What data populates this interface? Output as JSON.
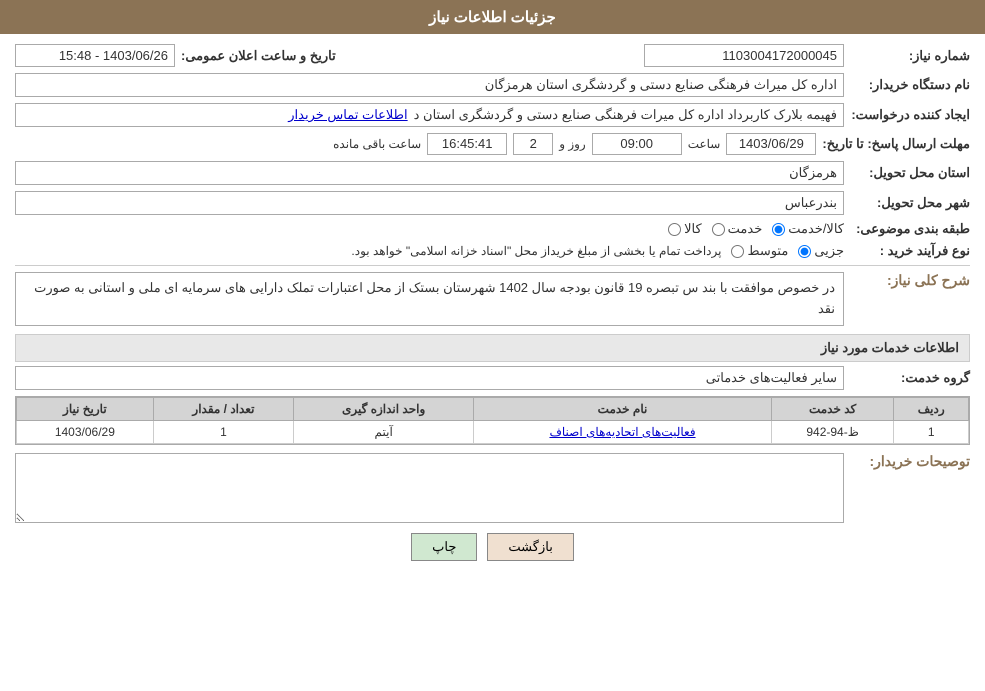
{
  "header": {
    "title": "جزئیات اطلاعات نیاز"
  },
  "fields": {
    "shomara_niaz_label": "شماره نیاز:",
    "shomara_niaz_value": "1103004172000045",
    "namdastgah_label": "نام دستگاه خریدار:",
    "namdastgah_value": "اداره کل میراث فرهنگی  صنایع دستی و گردشگری استان هرمزگان",
    "ijad_konande_label": "ایجاد کننده درخواست:",
    "ijad_konande_value": "فهیمه بلارک کاربرداد اداره کل میرات فرهنگی  صنایع دستی و گردشگری استان د",
    "ijad_konande_link": "اطلاعات تماس خریدار",
    "mohlet_label": "مهلت ارسال پاسخ: تا تاریخ:",
    "mohlet_date": "1403/06/29",
    "mohlet_saat_label": "ساعت",
    "mohlet_saat_value": "09:00",
    "mohlet_rooz_label": "روز و",
    "mohlet_rooz_value": "2",
    "mohlet_baghimande_label": "ساعت باقی مانده",
    "mohlet_baghimande_value": "16:45:41",
    "ostan_label": "استان محل تحویل:",
    "ostan_value": "هرمزگان",
    "shahr_label": "شهر محل تحویل:",
    "shahr_value": "بندرعباس",
    "tabaqe_label": "طبقه بندی موضوعی:",
    "tabaqe_kala": "کالا",
    "tabaqe_khedmat": "خدمت",
    "tabaqe_kala_khedmat": "کالا/خدمت",
    "noue_farayand_label": "نوع فرآیند خرید :",
    "noue_jozi": "جزیی",
    "noue_motevaset": "متوسط",
    "noue_desc": "پرداخت تمام یا بخشی از مبلغ خریداز محل \"اسناد خزانه اسلامی\" خواهد بود.",
    "taarikh_ijad_label": "تاریخ و ساعت اعلان عمومی:",
    "taarikh_ijad_value": "1403/06/26 - 15:48",
    "sharh_koli_label": "شرح کلی نیاز:",
    "sharh_koli_value": "در خصوص موافقت با بند س تبصره 19 قانون بودجه سال 1402 شهرستان بستک از محل اعتبارات تملک دارایی های سرمایه ای ملی و استانی به صورت نقد",
    "khadamat_label": "اطلاعات خدمات مورد نیاز",
    "gorouh_label": "گروه خدمت:",
    "gorouh_value": "سایر فعالیت‌های خدماتی",
    "table": {
      "headers": [
        "ردیف",
        "کد خدمت",
        "نام خدمت",
        "واحد اندازه گیری",
        "تعداد / مقدار",
        "تاریخ نیاز"
      ],
      "rows": [
        {
          "radif": "1",
          "kod_khedmat": "ظ-94-942",
          "nam_khedmat": "فعالیت‌های اتحادیه‌های اصناف",
          "vahed": "آیتم",
          "tedad": "1",
          "tarikh": "1403/06/29"
        }
      ]
    },
    "buyer_desc_label": "توصیحات خریدار:",
    "buyer_desc_value": ""
  },
  "buttons": {
    "print": "چاپ",
    "back": "بازگشت"
  }
}
